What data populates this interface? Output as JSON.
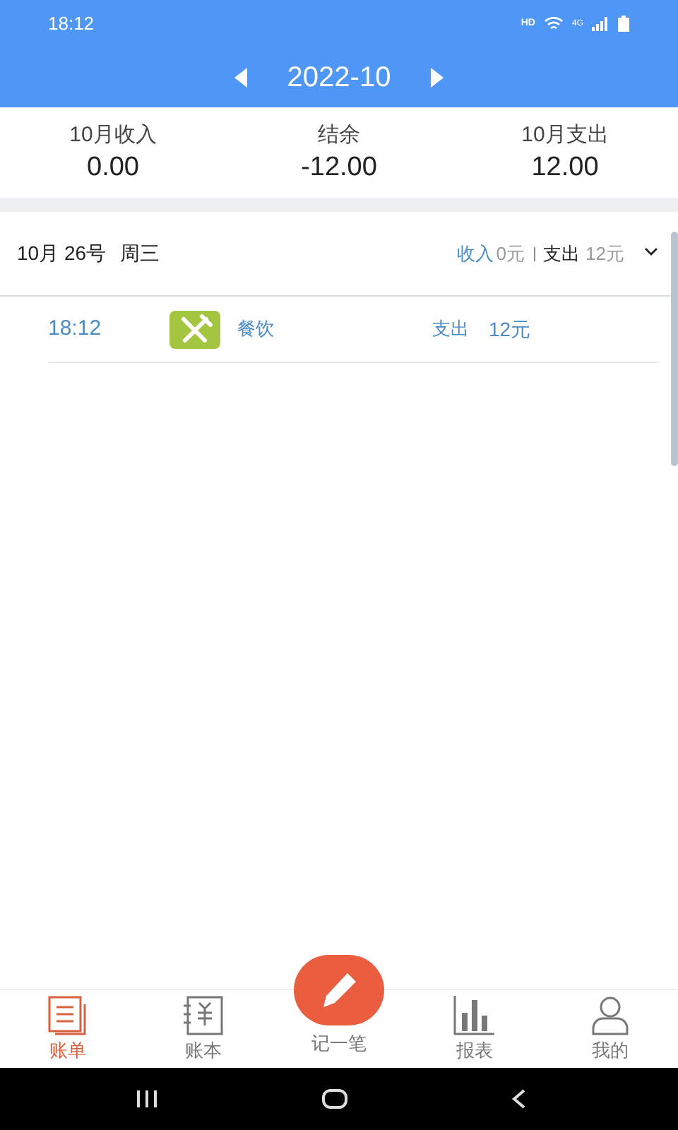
{
  "status_bar": {
    "time": "18:12",
    "hd": "HD",
    "network": "4G"
  },
  "header": {
    "month": "2022-10"
  },
  "summary": [
    {
      "label": "10月收入",
      "value": "0.00"
    },
    {
      "label": "结余",
      "value": "-12.00"
    },
    {
      "label": "10月支出",
      "value": "12.00"
    }
  ],
  "days": [
    {
      "date": "10月 26号",
      "weekday": "周三",
      "income_label": "收入",
      "income": "0元",
      "expense_label": "支出",
      "expense": "12元",
      "expanded": true,
      "entries": [
        {
          "time": "18:12",
          "category": "餐饮",
          "type": "支出",
          "amount": "12元"
        }
      ]
    }
  ],
  "tabs": [
    {
      "kind": "bill",
      "label": "账单",
      "selected": true
    },
    {
      "kind": "book",
      "label": "账本",
      "selected": false
    },
    {
      "kind": "record",
      "label": "记一笔",
      "selected": false
    },
    {
      "kind": "report",
      "label": "报表",
      "selected": false
    },
    {
      "kind": "me",
      "label": "我的",
      "selected": false
    }
  ]
}
